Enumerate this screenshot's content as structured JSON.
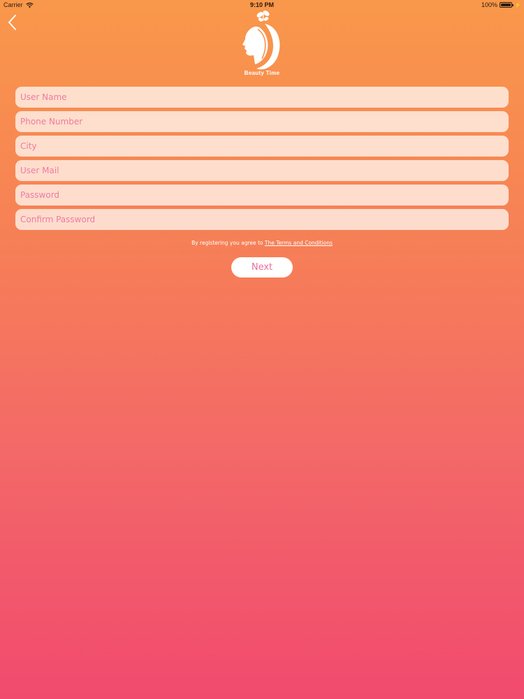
{
  "status_bar": {
    "carrier": "Carrier",
    "time": "9:10 PM",
    "battery": "100%"
  },
  "nav": {
    "back_icon": "chevron-left-icon"
  },
  "logo": {
    "text": "Beauty Time",
    "icon": "woman-profile-butterfly-logo"
  },
  "form": {
    "fields": [
      {
        "placeholder": "User Name",
        "value": ""
      },
      {
        "placeholder": "Phone Number",
        "value": ""
      },
      {
        "placeholder": "City",
        "value": ""
      },
      {
        "placeholder": "User Mail",
        "value": ""
      },
      {
        "placeholder": "Password",
        "value": ""
      },
      {
        "placeholder": "Confirm Password",
        "value": ""
      }
    ]
  },
  "terms": {
    "prefix": "By registering you agree to",
    "link": "The Terms and Conditions"
  },
  "next_button": {
    "label": "Next"
  },
  "colors": {
    "gradient_top": "#F9984A",
    "gradient_bottom": "#F14A6E",
    "field_text": "#EE7BA0",
    "button_text": "#EA6F9C"
  }
}
